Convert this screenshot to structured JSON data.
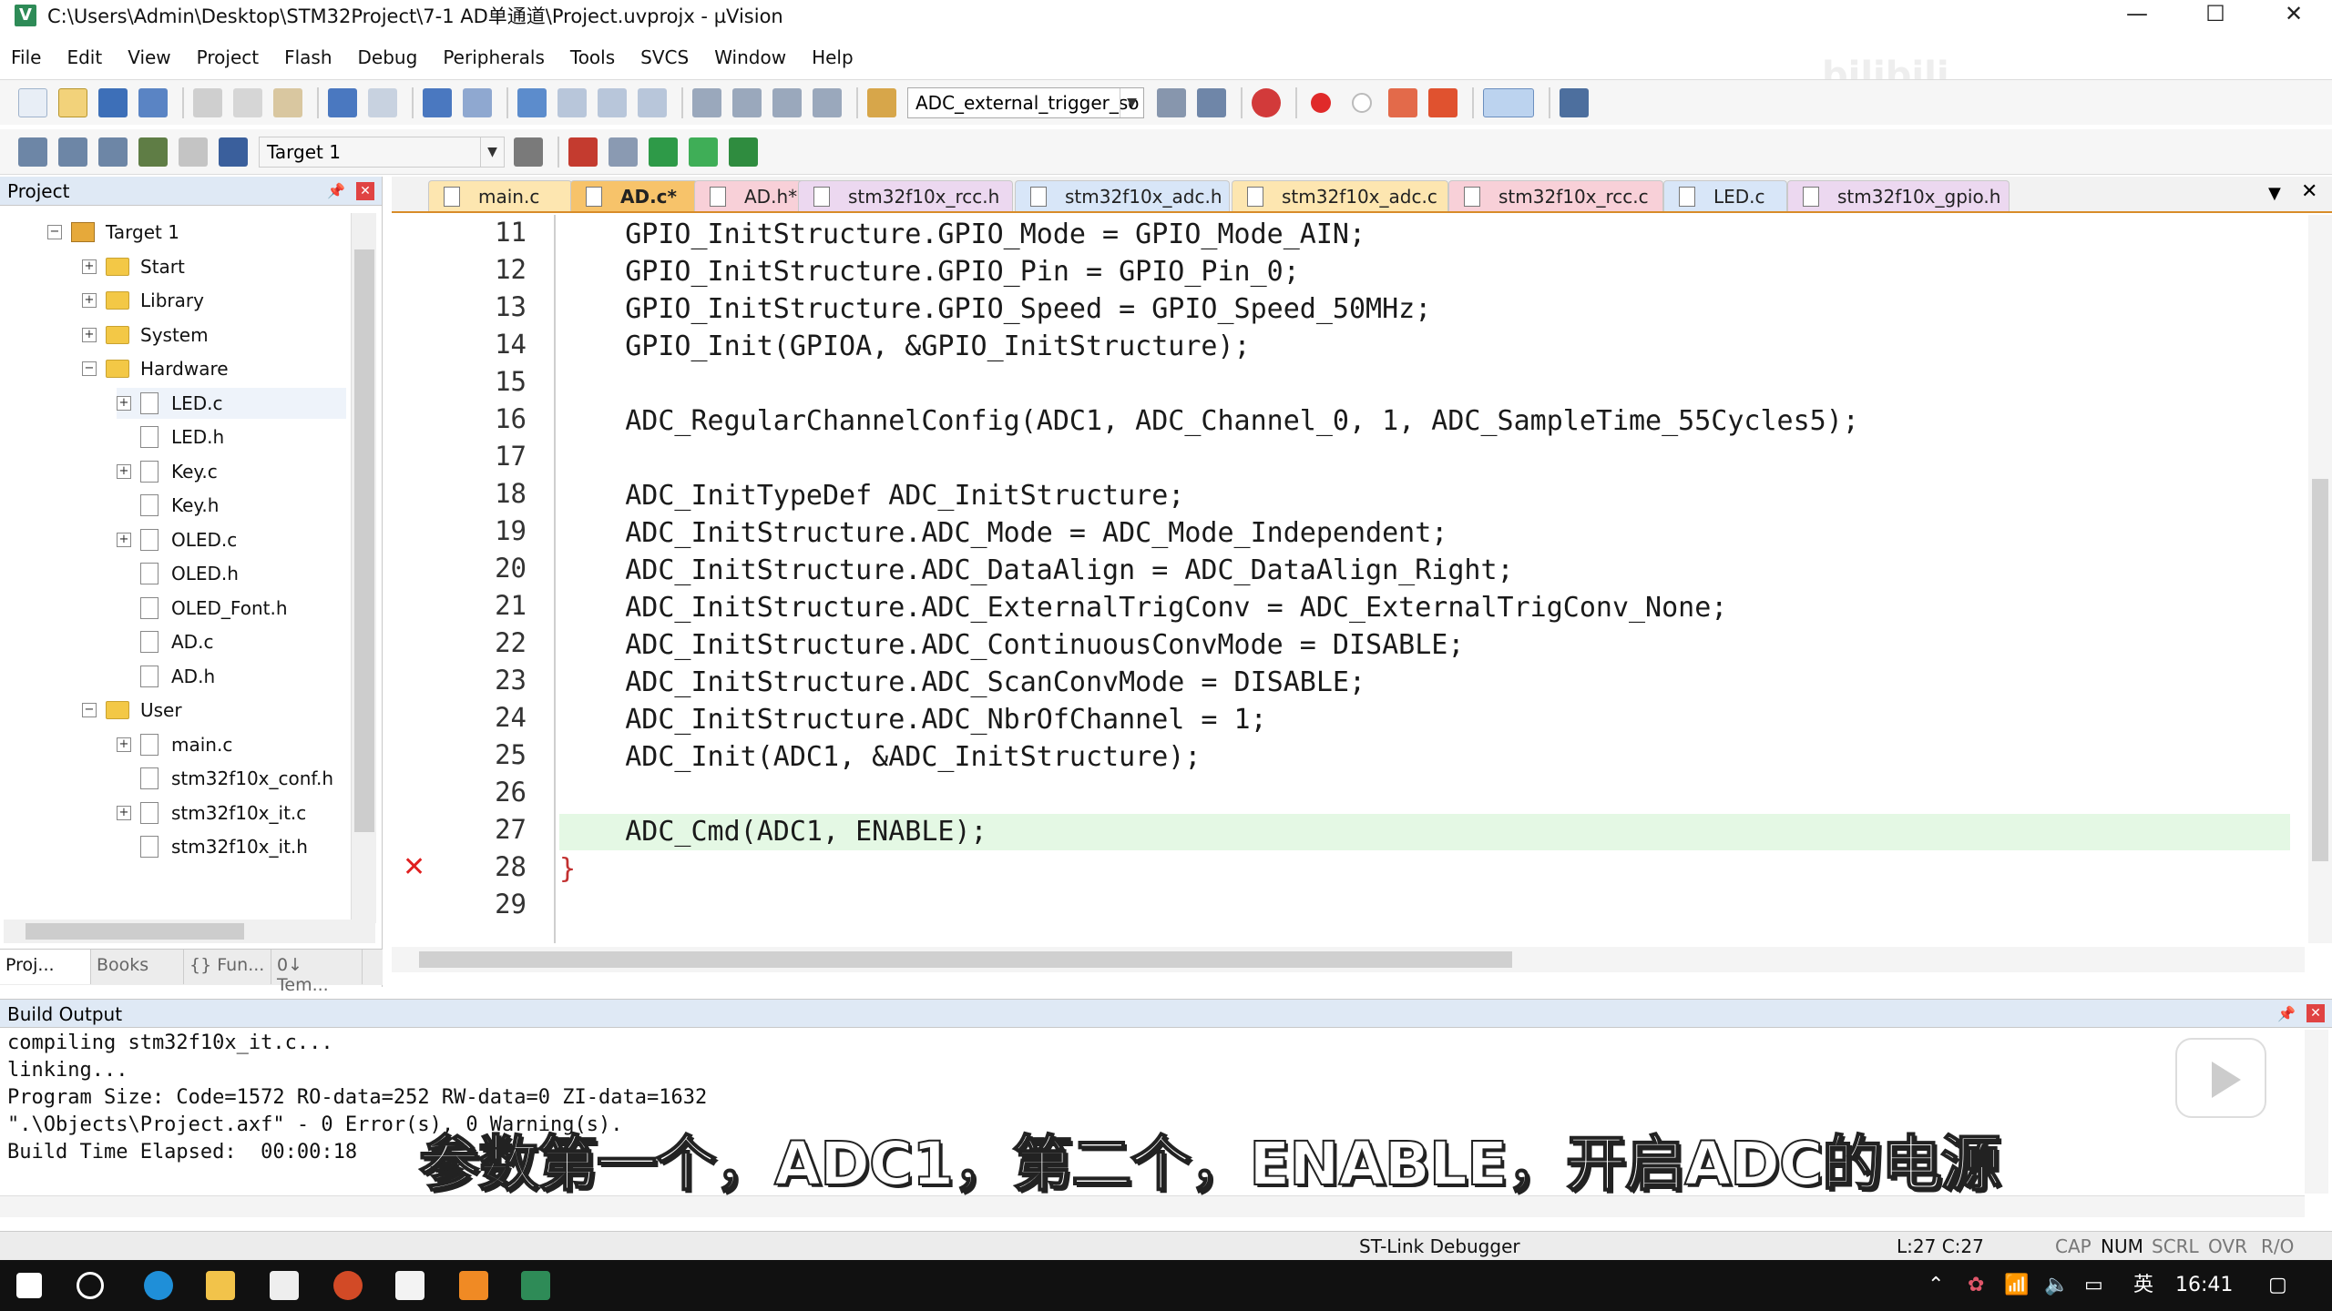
{
  "window": {
    "title": "C:\\Users\\Admin\\Desktop\\STM32Project\\7-1 AD单通道\\Project.uvprojx - µVision",
    "minimize": "—",
    "maximize": "☐",
    "close": "✕"
  },
  "menu": [
    "File",
    "Edit",
    "View",
    "Project",
    "Flash",
    "Debug",
    "Peripherals",
    "Tools",
    "SVCS",
    "Window",
    "Help"
  ],
  "toolbar": {
    "find_combo_value": "ADC_external_trigger_so",
    "target_combo_value": "Target 1"
  },
  "project_panel": {
    "title": "Project",
    "tree": [
      {
        "label": "Target 1",
        "type": "target",
        "expander": "−"
      },
      {
        "label": "Start",
        "type": "folder",
        "expander": "+"
      },
      {
        "label": "Library",
        "type": "folder",
        "expander": "+"
      },
      {
        "label": "System",
        "type": "folder",
        "expander": "+"
      },
      {
        "label": "Hardware",
        "type": "folder",
        "expander": "−"
      },
      {
        "label": "LED.c",
        "type": "file",
        "expander": "+"
      },
      {
        "label": "LED.h",
        "type": "file",
        "expander": ""
      },
      {
        "label": "Key.c",
        "type": "file",
        "expander": "+"
      },
      {
        "label": "Key.h",
        "type": "file",
        "expander": ""
      },
      {
        "label": "OLED.c",
        "type": "file",
        "expander": "+"
      },
      {
        "label": "OLED.h",
        "type": "file",
        "expander": ""
      },
      {
        "label": "OLED_Font.h",
        "type": "file",
        "expander": ""
      },
      {
        "label": "AD.c",
        "type": "file",
        "expander": ""
      },
      {
        "label": "AD.h",
        "type": "file",
        "expander": ""
      },
      {
        "label": "User",
        "type": "folder",
        "expander": "−"
      },
      {
        "label": "main.c",
        "type": "file",
        "expander": "+"
      },
      {
        "label": "stm32f10x_conf.h",
        "type": "file",
        "expander": ""
      },
      {
        "label": "stm32f10x_it.c",
        "type": "file",
        "expander": "+"
      },
      {
        "label": "stm32f10x_it.h",
        "type": "file",
        "expander": ""
      }
    ],
    "bottom_tabs": [
      "Proj...",
      "Books",
      "{} Fun...",
      "0↓ Tem..."
    ]
  },
  "editor": {
    "tabs": [
      "main.c",
      "AD.c*",
      "AD.h*",
      "stm32f10x_rcc.h",
      "stm32f10x_adc.h",
      "stm32f10x_adc.c",
      "stm32f10x_rcc.c",
      "LED.c",
      "stm32f10x_gpio.h"
    ],
    "active_tab": "AD.c*",
    "line_numbers": [
      "11",
      "12",
      "13",
      "14",
      "15",
      "16",
      "17",
      "18",
      "19",
      "20",
      "21",
      "22",
      "23",
      "24",
      "25",
      "26",
      "27",
      "28",
      "29"
    ],
    "error_mark": "✕",
    "code_lines": [
      "    GPIO_InitStructure.GPIO_Mode = GPIO_Mode_AIN;",
      "    GPIO_InitStructure.GPIO_Pin = GPIO_Pin_0;",
      "    GPIO_InitStructure.GPIO_Speed = GPIO_Speed_50MHz;",
      "    GPIO_Init(GPIOA, &GPIO_InitStructure);",
      "",
      "    ADC_RegularChannelConfig(ADC1, ADC_Channel_0, 1, ADC_SampleTime_55Cycles5);",
      "",
      "    ADC_InitTypeDef ADC_InitStructure;",
      "    ADC_InitStructure.ADC_Mode = ADC_Mode_Independent;",
      "    ADC_InitStructure.ADC_DataAlign = ADC_DataAlign_Right;",
      "    ADC_InitStructure.ADC_ExternalTrigConv = ADC_ExternalTrigConv_None;",
      "    ADC_InitStructure.ADC_ContinuousConvMode = DISABLE;",
      "    ADC_InitStructure.ADC_ScanConvMode = DISABLE;",
      "    ADC_InitStructure.ADC_NbrOfChannel = 1;",
      "    ADC_Init(ADC1, &ADC_InitStructure);",
      "",
      "    ADC_Cmd(ADC1, ENABLE);",
      "}",
      ""
    ]
  },
  "build_output": {
    "title": "Build Output",
    "lines": [
      "compiling stm32f10x_it.c...",
      "linking...",
      "Program Size: Code=1572 RO-data=252 RW-data=0 ZI-data=1632",
      "\".\\Objects\\Project.axf\" - 0 Error(s), 0 Warning(s).",
      "Build Time Elapsed:  00:00:18"
    ]
  },
  "subtitle": "参数第一个，ADC1，第二个，ENABLE，开启ADC的电源",
  "status_bar": {
    "debugger": "ST-Link Debugger",
    "position": "L:27 C:27",
    "caps": "CAP",
    "num": "NUM",
    "scrl": "SCRL",
    "ovr": "OVR",
    "ro": "R/O"
  },
  "taskbar": {
    "ime": "英",
    "clock": "16:41"
  }
}
